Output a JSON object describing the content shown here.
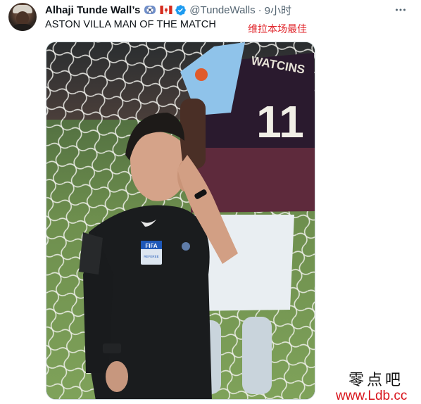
{
  "tweet": {
    "display_name": "Alhaji Tunde Wall’s",
    "handle": "@TundeWalls",
    "separator": "·",
    "time": "9小时",
    "text": "ASTON VILLA MAN OF THE MATCH",
    "translation": "维拉本场最佳",
    "name_emojis": [
      "soccer-ball-emoji",
      "canada-flag-emoji"
    ],
    "verified": true,
    "more_icon": "ellipsis-icon"
  },
  "photo": {
    "jersey_name": "WATCINS",
    "jersey_number": "11",
    "badge_text": "FIFA",
    "badge_subtext": "REFEREE"
  },
  "watermark": {
    "site_name": "零点吧",
    "site_url": "www.Ldb.cc"
  },
  "colors": {
    "name": "#0f1419",
    "secondary": "#536471",
    "verified": "#1d9bf0",
    "translation": "#e0242a",
    "watermark_url": "#d8141c"
  }
}
